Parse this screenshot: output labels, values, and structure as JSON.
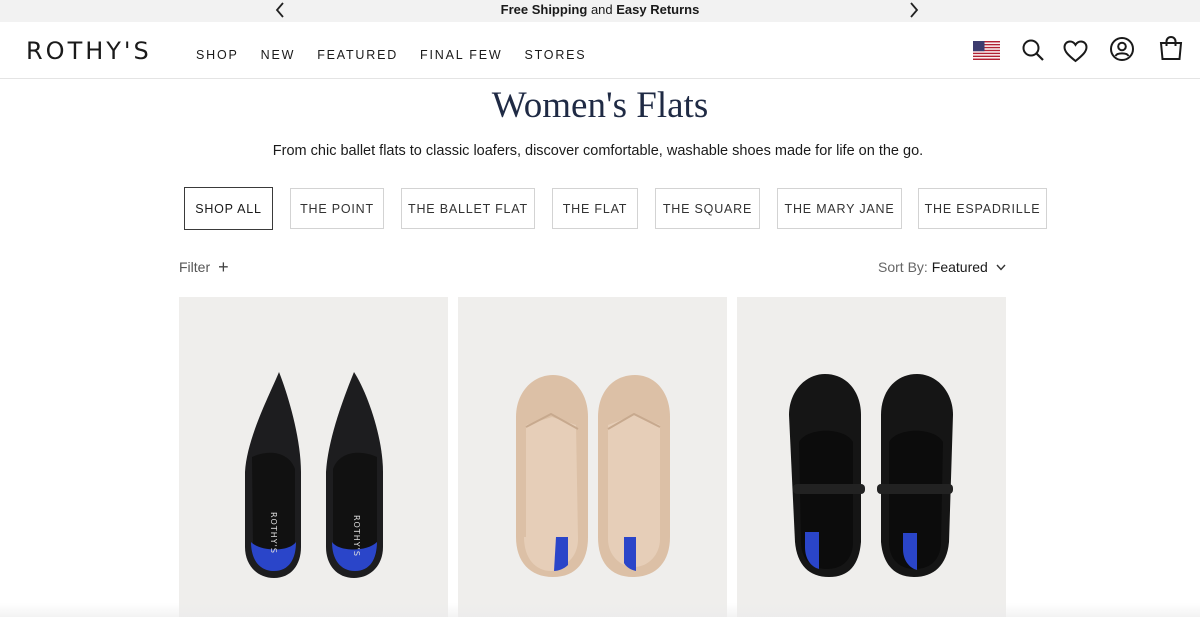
{
  "announcement": {
    "part1": "Free Shipping",
    "part2": "and",
    "part3": "Easy Returns"
  },
  "header": {
    "logo": "ROTHY'S",
    "nav": [
      "SHOP",
      "NEW",
      "FEATURED",
      "FINAL FEW",
      "STORES"
    ],
    "icons": [
      "us-flag-icon",
      "search-icon",
      "heart-icon",
      "account-icon",
      "bag-icon"
    ]
  },
  "page": {
    "title": "Women's Flats",
    "subtitle": "From chic ballet flats to classic loafers, discover comfortable, washable shoes made for life on the go."
  },
  "categories": [
    "SHOP ALL",
    "THE POINT",
    "THE BALLET FLAT",
    "THE FLAT",
    "THE SQUARE",
    "THE MARY JANE",
    "THE ESPADRILLE"
  ],
  "active_category": "SHOP ALL",
  "toolbar": {
    "filter_label": "Filter",
    "filter_icon": "plus-icon",
    "sort_label": "Sort By:",
    "sort_value": "Featured"
  },
  "products": [
    {
      "style": "pointed-flat",
      "color": "#1d1d1f",
      "insole_text": "ROTHY'S",
      "accent": "#2a45c9"
    },
    {
      "style": "ballet-flat",
      "color": "#dcc0a6",
      "insole_text": "",
      "accent": "#2a45c9"
    },
    {
      "style": "mary-jane",
      "color": "#151515",
      "insole_text": "",
      "accent": "#2a45c9"
    }
  ],
  "colors": {
    "title": "#1f2a44",
    "card_bg": "#efeeec",
    "announcement_bg": "#f2f2f2"
  }
}
